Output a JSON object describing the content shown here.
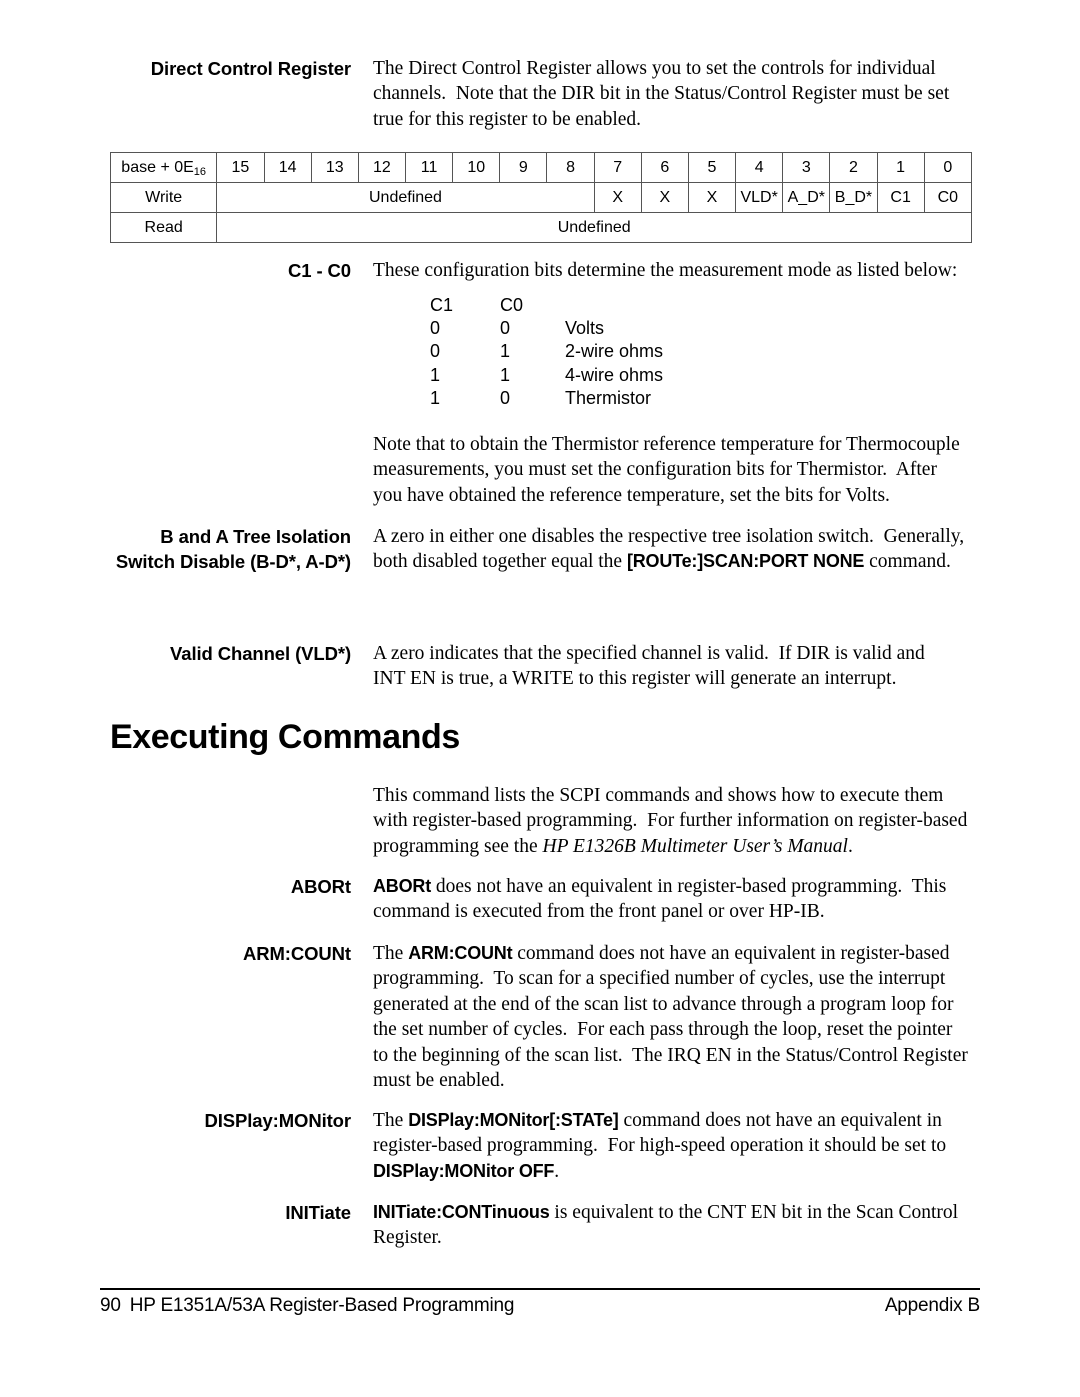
{
  "page": {
    "footer": {
      "page_number": "90",
      "title": "HP E1351A/53A Register-Based Programming",
      "appendix": "Appendix B"
    }
  },
  "direct_control": {
    "heading_line1": "Direct Control",
    "heading_line2": "Register",
    "body_line1": "The Direct Control Register allows you to set the controls for individual",
    "body_line2": "channels.  Note that the DIR bit in the Status/Control Register must be set",
    "body_line3": "true for this register to be enabled."
  },
  "register_table": {
    "address_label_prefix": "base + 0E",
    "address_label_sub": "16",
    "bits": [
      "15",
      "14",
      "13",
      "12",
      "11",
      "10",
      "9",
      "8",
      "7",
      "6",
      "5",
      "4",
      "3",
      "2",
      "1",
      "0"
    ],
    "write_row": {
      "label": "Write",
      "undefined_span_label": "Undefined",
      "cells": [
        "X",
        "X",
        "X",
        "VLD*",
        "A_D*",
        "B_D*",
        "C1",
        "C0"
      ]
    },
    "read_row": {
      "label": "Read",
      "undefined_label": "Undefined"
    }
  },
  "c1_c0": {
    "heading": "C1 - C0",
    "body_line1": "These configuration bits determine the measurement mode as listed below:"
  },
  "mode_table": {
    "type": "table",
    "headers": [
      "C1",
      "C0",
      ""
    ],
    "rows": [
      {
        "c1": "0",
        "c0": "0",
        "mode": "Volts"
      },
      {
        "c1": "0",
        "c0": "1",
        "mode": "2-wire ohms"
      },
      {
        "c1": "1",
        "c0": "1",
        "mode": "4-wire ohms"
      },
      {
        "c1": "1",
        "c0": "0",
        "mode": "Thermistor"
      }
    ]
  },
  "thermistor_note": {
    "line1": "Note that to obtain the Thermistor reference temperature for Thermocouple",
    "line2": "measurements, you must set the configuration bits for Thermistor.  After",
    "line3": "you have obtained the reference temperature, set the bits for Volts."
  },
  "tree_isolation": {
    "heading_line1": "B and A Tree Isolation",
    "heading_line2": "Switch Disable",
    "heading_line3": "(B-D*, A-D*)",
    "body_line1": "A zero in either one disables the respective tree isolation switch.  Generally,",
    "body_line2_pre": "both disabled together equal the ",
    "body_line2_bold": "[ROUTe:]SCAN:PORT NONE",
    "body_line2_post": " command."
  },
  "valid_channel": {
    "heading": "Valid Channel (VLD*)",
    "body_line1": "A zero indicates that the specified channel is valid.  If DIR is valid and",
    "body_line2": "INT EN is true, a WRITE to this register will generate an interrupt."
  },
  "executing_commands": {
    "heading": "Executing Commands",
    "intro_line1": "This command lists the SCPI commands and shows how to execute them",
    "intro_line2": "with register-based programming.  For further information on register-based",
    "intro_line3_pre": "programming see the ",
    "intro_line3_italic": "HP E1326B Multimeter User’s Manual",
    "intro_line3_post": "."
  },
  "abort": {
    "heading": "ABORt",
    "body_line1_bold": "ABORt",
    "body_line1_rest": " does not have an equivalent in register-based programming.  This",
    "body_line2": "command is executed from the front panel or over HP-IB."
  },
  "arm_count": {
    "heading": "ARM:COUNt",
    "body_line1_pre": "The ",
    "body_line1_bold": "ARM:COUNt",
    "body_line1_post": " command does not have an equivalent in register-based",
    "body_line2": "programming.  To scan for a specified number of cycles, use the interrupt",
    "body_line3": "generated at the end of the scan list to advance through a program loop for",
    "body_line4": "the set number of cycles.  For each pass through the loop, reset the pointer",
    "body_line5": "to the beginning of the scan list.  The IRQ EN in the Status/Control Register",
    "body_line6": "must be enabled."
  },
  "display_monitor": {
    "heading": "DISPlay:MONitor",
    "body_line1_pre": "The ",
    "body_line1_bold": "DISPlay:MONitor[:STATe]",
    "body_line1_post": " command does not have an equivalent in",
    "body_line2": "register-based programming.  For high-speed operation it should be set to",
    "body_line3_bold": "DISPlay:MONitor OFF",
    "body_line3_post": "."
  },
  "initiate": {
    "heading": "INITiate",
    "body_line1_bold": "INITiate:CONTinuous",
    "body_line1_post": " is equivalent to the CNT EN bit in the Scan Control",
    "body_line2": "Register."
  }
}
